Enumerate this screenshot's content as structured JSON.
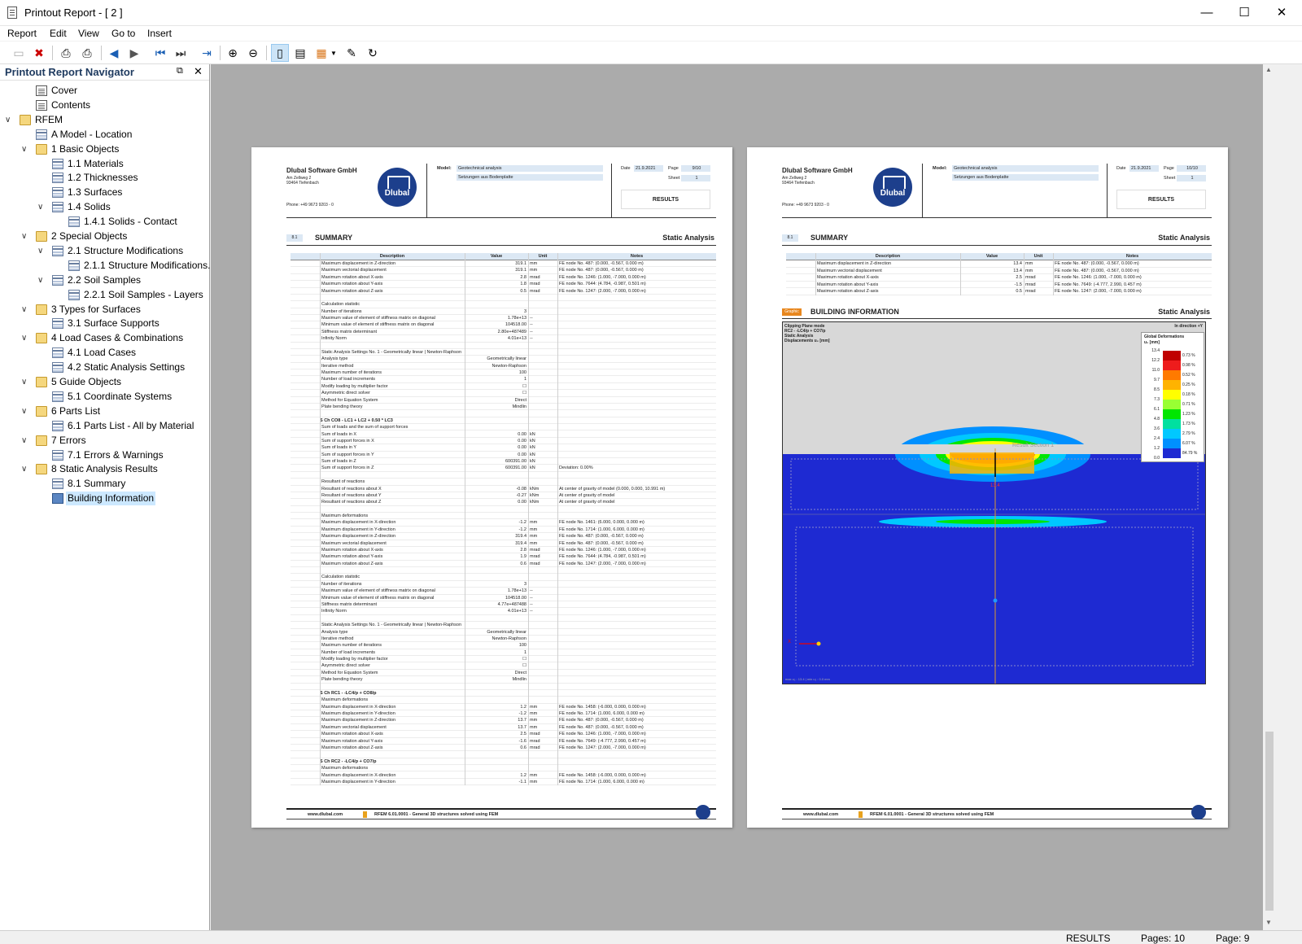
{
  "window": {
    "title": "Printout Report - [ 2 ]",
    "minimize": "—",
    "maximize": "☐",
    "close": "✕"
  },
  "menu": [
    "Report",
    "Edit",
    "View",
    "Go to",
    "Insert"
  ],
  "navigator": {
    "title": "Printout Report Navigator",
    "items": [
      {
        "label": "Cover",
        "icon": "doc",
        "level": 1
      },
      {
        "label": "Contents",
        "icon": "doc",
        "level": 1
      },
      {
        "label": "RFEM",
        "icon": "folder",
        "level": 0,
        "expanded": true
      },
      {
        "label": "A Model - Location",
        "icon": "table",
        "level": 1
      },
      {
        "label": "1 Basic Objects",
        "icon": "folder",
        "level": 1,
        "expanded": true
      },
      {
        "label": "1.1 Materials",
        "icon": "table",
        "level": 2
      },
      {
        "label": "1.2 Thicknesses",
        "icon": "table",
        "level": 2
      },
      {
        "label": "1.3 Surfaces",
        "icon": "table",
        "level": 2
      },
      {
        "label": "1.4 Solids",
        "icon": "table",
        "level": 2,
        "expanded": true
      },
      {
        "label": "1.4.1 Solids - Contact",
        "icon": "table",
        "level": 3
      },
      {
        "label": "2 Special Objects",
        "icon": "folder",
        "level": 1,
        "expanded": true
      },
      {
        "label": "2.1 Structure Modifications",
        "icon": "table",
        "level": 2,
        "expanded": true
      },
      {
        "label": "2.1.1 Structure Modifications...",
        "icon": "table",
        "level": 3
      },
      {
        "label": "2.2 Soil Samples",
        "icon": "table",
        "level": 2,
        "expanded": true
      },
      {
        "label": "2.2.1 Soil Samples - Layers",
        "icon": "table",
        "level": 3
      },
      {
        "label": "3 Types for Surfaces",
        "icon": "folder",
        "level": 1,
        "expanded": true
      },
      {
        "label": "3.1 Surface Supports",
        "icon": "table",
        "level": 2
      },
      {
        "label": "4 Load Cases & Combinations",
        "icon": "folder",
        "level": 1,
        "expanded": true
      },
      {
        "label": "4.1 Load Cases",
        "icon": "table",
        "level": 2
      },
      {
        "label": "4.2 Static Analysis Settings",
        "icon": "table",
        "level": 2
      },
      {
        "label": "5 Guide Objects",
        "icon": "folder",
        "level": 1,
        "expanded": true
      },
      {
        "label": "5.1 Coordinate Systems",
        "icon": "table",
        "level": 2
      },
      {
        "label": "6 Parts List",
        "icon": "folder",
        "level": 1,
        "expanded": true
      },
      {
        "label": "6.1 Parts List - All by Material",
        "icon": "table",
        "level": 2
      },
      {
        "label": "7 Errors",
        "icon": "folder",
        "level": 1,
        "expanded": true
      },
      {
        "label": "7.1 Errors & Warnings",
        "icon": "table",
        "level": 2
      },
      {
        "label": "8 Static Analysis Results",
        "icon": "folder",
        "level": 1,
        "expanded": true
      },
      {
        "label": "8.1 Summary",
        "icon": "table",
        "level": 2
      },
      {
        "label": "Building Information",
        "icon": "graph",
        "level": 2,
        "selected": true
      }
    ]
  },
  "page_left": {
    "company": "Dlubal Software GmbH",
    "street": "Am Zellweg 2",
    "city": "93464 Tiefenbach",
    "phone": "Phone: +49 9673 9203 - 0",
    "logo": "Dlubal",
    "model_label": "Model:",
    "model": "Geotechnical analysis",
    "model_sub": "Setzungen aus Bodenplatte",
    "date_label": "Date",
    "date": "21.9.2021",
    "page_label": "Page",
    "page": "9/10",
    "sheet_label": "Sheet",
    "sheet": "1",
    "results": "RESULTS",
    "sect_no": "8.1",
    "sect_title": "SUMMARY",
    "sect_right": "Static Analysis",
    "headers": [
      "Description",
      "Value",
      "Unit",
      "Notes"
    ],
    "rows": [
      [
        "Maximum displacement in Z-direction",
        "319.1",
        "mm",
        "FE node No. 487: (0.000, -0.567, 0.000 m)"
      ],
      [
        "Maximum vectorial displacement",
        "319.1",
        "mm",
        "FE node No. 487: (0.000, -0.567, 0.000 m)"
      ],
      [
        "Maximum rotation about X-axis",
        "2.8",
        "mrad",
        "FE node No. 1246: (1.000, -7.000, 0.000 m)"
      ],
      [
        "Maximum rotation about Y-axis",
        "1.8",
        "mrad",
        "FE node No. 7644: (4.784, -0.987, 0.501 m)"
      ],
      [
        "Maximum rotation about Z-axis",
        "0.5",
        "mrad",
        "FE node No. 1247: (2.000, -7.000, 0.000 m)"
      ],
      [
        "",
        "",
        "",
        ""
      ],
      [
        "Calculation statistic",
        "",
        "",
        ""
      ],
      [
        "Number of iterations",
        "3",
        "",
        ""
      ],
      [
        "Maximum value of element of stiffness matrix on diagonal",
        "1.78e+13",
        "--",
        ""
      ],
      [
        "Minimum value of element of stiffness matrix on diagonal",
        "104518.00",
        "--",
        ""
      ],
      [
        "Stiffness matrix determinant",
        "2.80e+487489",
        "--",
        ""
      ],
      [
        "Infinity Norm",
        "4.01e+13",
        "--",
        ""
      ],
      [
        "",
        "",
        "",
        ""
      ],
      [
        "Static Analysis Settings No. 1 - Geometrically linear | Newton-Raphson",
        "",
        "",
        ""
      ],
      [
        "Analysis type",
        "Geometrically linear",
        "",
        ""
      ],
      [
        "Iterative method",
        "Newton-Raphson",
        "",
        ""
      ],
      [
        "Maximum number of iterations",
        "100",
        "",
        ""
      ],
      [
        "Number of load increments",
        "1",
        "",
        ""
      ],
      [
        "Modify loading by multiplier factor",
        "☐",
        "",
        ""
      ],
      [
        "Asymmetric direct solver",
        "☐",
        "",
        ""
      ],
      [
        "Method for Equation System",
        "Direct",
        "",
        ""
      ],
      [
        "Plate bending theory",
        "Mindlin",
        "",
        ""
      ],
      [
        "",
        "",
        "",
        ""
      ],
      [
        "S Ch  CO8 - LC1 + LC2 + 0.50 * LC3",
        "",
        "",
        ""
      ],
      [
        "Sum of loads and the sum of support forces",
        "",
        "",
        ""
      ],
      [
        "Sum of loads in X",
        "0.00",
        "kN",
        ""
      ],
      [
        "Sum of support forces in X",
        "0.00",
        "kN",
        ""
      ],
      [
        "Sum of loads in Y",
        "0.00",
        "kN",
        ""
      ],
      [
        "Sum of support forces in Y",
        "0.00",
        "kN",
        ""
      ],
      [
        "Sum of loads in Z",
        "600391.00",
        "kN",
        ""
      ],
      [
        "Sum of support forces in Z",
        "600391.00",
        "kN",
        "Deviation: 0.00%"
      ],
      [
        "",
        "",
        "",
        ""
      ],
      [
        "Resultant of reactions",
        "",
        "",
        ""
      ],
      [
        "Resultant of reactions about X",
        "-0.08",
        "kNm",
        "At center of gravity of model (0.000, 0.000, 10.991 m)"
      ],
      [
        "Resultant of reactions about Y",
        "-0.27",
        "kNm",
        "At center of gravity of model"
      ],
      [
        "Resultant of reactions about Z",
        "0.00",
        "kNm",
        "At center of gravity of model"
      ],
      [
        "",
        "",
        "",
        ""
      ],
      [
        "Maximum deformations",
        "",
        "",
        ""
      ],
      [
        "Maximum displacement in X-direction",
        "-1.2",
        "mm",
        "FE node No. 1461: (6.000, 0.000, 0.000 m)"
      ],
      [
        "Maximum displacement in Y-direction",
        "-1.2",
        "mm",
        "FE node No. 1714: (1.000, 6.000, 0.000 m)"
      ],
      [
        "Maximum displacement in Z-direction",
        "319.4",
        "mm",
        "FE node No. 487: (0.000, -0.567, 0.000 m)"
      ],
      [
        "Maximum vectorial displacement",
        "319.4",
        "mm",
        "FE node No. 487: (0.000, -0.567, 0.000 m)"
      ],
      [
        "Maximum rotation about X-axis",
        "2.8",
        "mrad",
        "FE node No. 1246: (1.000, -7.000, 0.000 m)"
      ],
      [
        "Maximum rotation about Y-axis",
        "1.9",
        "mrad",
        "FE node No. 7644: (4.784, -0.987, 0.501 m)"
      ],
      [
        "Maximum rotation about Z-axis",
        "0.6",
        "mrad",
        "FE node No. 1247: (2.000, -7.000, 0.000 m)"
      ],
      [
        "",
        "",
        "",
        ""
      ],
      [
        "Calculation statistic",
        "",
        "",
        ""
      ],
      [
        "Number of iterations",
        "3",
        "",
        ""
      ],
      [
        "Maximum value of element of stiffness matrix on diagonal",
        "1.78e+13",
        "--",
        ""
      ],
      [
        "Minimum value of element of stiffness matrix on diagonal",
        "104518.00",
        "--",
        ""
      ],
      [
        "Stiffness matrix determinant",
        "4.77e+487488",
        "--",
        ""
      ],
      [
        "Infinity Norm",
        "4.01e+13",
        "--",
        ""
      ],
      [
        "",
        "",
        "",
        ""
      ],
      [
        "Static Analysis Settings No. 1 - Geometrically linear | Newton-Raphson",
        "",
        "",
        ""
      ],
      [
        "Analysis type",
        "Geometrically linear",
        "",
        ""
      ],
      [
        "Iterative method",
        "Newton-Raphson",
        "",
        ""
      ],
      [
        "Maximum number of iterations",
        "100",
        "",
        ""
      ],
      [
        "Number of load increments",
        "1",
        "",
        ""
      ],
      [
        "Modify loading by multiplier factor",
        "☐",
        "",
        ""
      ],
      [
        "Asymmetric direct solver",
        "☐",
        "",
        ""
      ],
      [
        "Method for Equation System",
        "Direct",
        "",
        ""
      ],
      [
        "Plate bending theory",
        "Mindlin",
        "",
        ""
      ],
      [
        "",
        "",
        "",
        ""
      ],
      [
        "S Ch  RC1 - -LC4/p + CO8/p",
        "",
        "",
        ""
      ],
      [
        "Maximum deformations",
        "",
        "",
        ""
      ],
      [
        "Maximum displacement in X-direction",
        "1.2",
        "mm",
        "FE node No. 1458: (-6.000, 0.000, 0.000 m)"
      ],
      [
        "Maximum displacement in Y-direction",
        "-1.2",
        "mm",
        "FE node No. 1714: (1.000, 6.000, 0.000 m)"
      ],
      [
        "Maximum displacement in Z-direction",
        "13.7",
        "mm",
        "FE node No. 487: (0.000, -0.567, 0.000 m)"
      ],
      [
        "Maximum vectorial displacement",
        "13.7",
        "mm",
        "FE node No. 487: (0.000, -0.567, 0.000 m)"
      ],
      [
        "Maximum rotation about X-axis",
        "2.5",
        "mrad",
        "FE node No. 1246: (1.000, -7.000, 0.000 m)"
      ],
      [
        "Maximum rotation about Y-axis",
        "-1.6",
        "mrad",
        "FE node No. 7649: (-4.777, 2.990, 0.457 m)"
      ],
      [
        "Maximum rotation about Z-axis",
        "0.6",
        "mrad",
        "FE node No. 1247: (2.000, -7.000, 0.000 m)"
      ],
      [
        "",
        "",
        "",
        ""
      ],
      [
        "S Ch  RC2 - -LC4/p + CO7/p",
        "",
        "",
        ""
      ],
      [
        "Maximum deformations",
        "",
        "",
        ""
      ],
      [
        "Maximum displacement in X-direction",
        "1.2",
        "mm",
        "FE node No. 1458: (-6.000, 0.000, 0.000 m)"
      ],
      [
        "Maximum displacement in Y-direction",
        "-1.1",
        "mm",
        "FE node No. 1714: (1.000, 6.000, 0.000 m)"
      ]
    ],
    "footer_url": "www.dlubal.com",
    "footer_text": "RFEM 6.01.0001 - General 3D structures solved using FEM"
  },
  "page_right": {
    "company": "Dlubal Software GmbH",
    "street": "Am Zellweg 2",
    "city": "93464 Tiefenbach",
    "phone": "Phone: +49 9673 9203 - 0",
    "logo": "Dlubal",
    "model_label": "Model:",
    "model": "Geotechnical analysis",
    "model_sub": "Setzungen aus Bodenplatte",
    "date_label": "Date",
    "date": "21.9.2021",
    "page_label": "Page",
    "page": "10/10",
    "sheet_label": "Sheet",
    "sheet": "1",
    "results": "RESULTS",
    "sect_no": "8.1",
    "sect_title": "SUMMARY",
    "sect_right": "Static Analysis",
    "headers": [
      "Description",
      "Value",
      "Unit",
      "Notes"
    ],
    "rows": [
      [
        "Maximum displacement in Z-direction",
        "13.4",
        "mm",
        "FE node No. 487: (0.000, -0.567, 0.000 m)"
      ],
      [
        "Maximum vectorial displacement",
        "13.4",
        "mm",
        "FE node No. 487: (0.000, -0.567, 0.000 m)"
      ],
      [
        "Maximum rotation about X-axis",
        "2.5",
        "mrad",
        "FE node No. 1246: (1.000, -7.000, 0.000 m)"
      ],
      [
        "Maximum rotation about Y-axis",
        "-1.5",
        "mrad",
        "FE node No. 7649: (-4.777, 2.990, 0.457 m)"
      ],
      [
        "Maximum rotation about Z-axis",
        "0.5",
        "mrad",
        "FE node No. 1247: (2.000, -7.000, 0.000 m)"
      ]
    ],
    "graphic_tag": "Graphic",
    "graphic_title": "BUILDING INFORMATION",
    "graphic_right": "Static Analysis",
    "graphic_info": [
      "Clipping Plane mode",
      "RC2 - -LC4/p + CO7/p",
      "Static Analysis",
      "Displacements u₂ [mm]"
    ],
    "direction": "In direction +Y",
    "result_section": "Result Section 1",
    "legend_title": "Global Deformations",
    "legend_unit": "u₂ [mm]",
    "legend": [
      {
        "v": "13.4",
        "p": "0.73 %",
        "c": "#c00000"
      },
      {
        "v": "12.2",
        "p": "0.98 %",
        "c": "#ee1c1c"
      },
      {
        "v": "11.0",
        "p": "0.52 %",
        "c": "#ff7a00"
      },
      {
        "v": "9.7",
        "p": "0.25 %",
        "c": "#ffb300"
      },
      {
        "v": "8.5",
        "p": "0.18 %",
        "c": "#ffff00"
      },
      {
        "v": "7.3",
        "p": "0.71 %",
        "c": "#99ff33"
      },
      {
        "v": "6.1",
        "p": "1.23 %",
        "c": "#00e600"
      },
      {
        "v": "4.8",
        "p": "1.73 %",
        "c": "#00e0a0"
      },
      {
        "v": "3.6",
        "p": "2.79 %",
        "c": "#00c8ff"
      },
      {
        "v": "2.4",
        "p": "6.07 %",
        "c": "#0090ff"
      },
      {
        "v": "1.2",
        "p": "84.79 %",
        "c": "#1e2ad2"
      },
      {
        "v": "0.0",
        "p": "",
        "c": ""
      }
    ],
    "max_label": "13.4",
    "bottom_left": "max u₂ : 13.4 | min u₂ : 0.0 mm",
    "footer_url": "www.dlubal.com",
    "footer_text": "RFEM 6.01.0001 - General 3D structures solved using FEM"
  },
  "status": {
    "label": "RESULTS",
    "pages": "Pages: 10",
    "page": "Page: 9"
  }
}
